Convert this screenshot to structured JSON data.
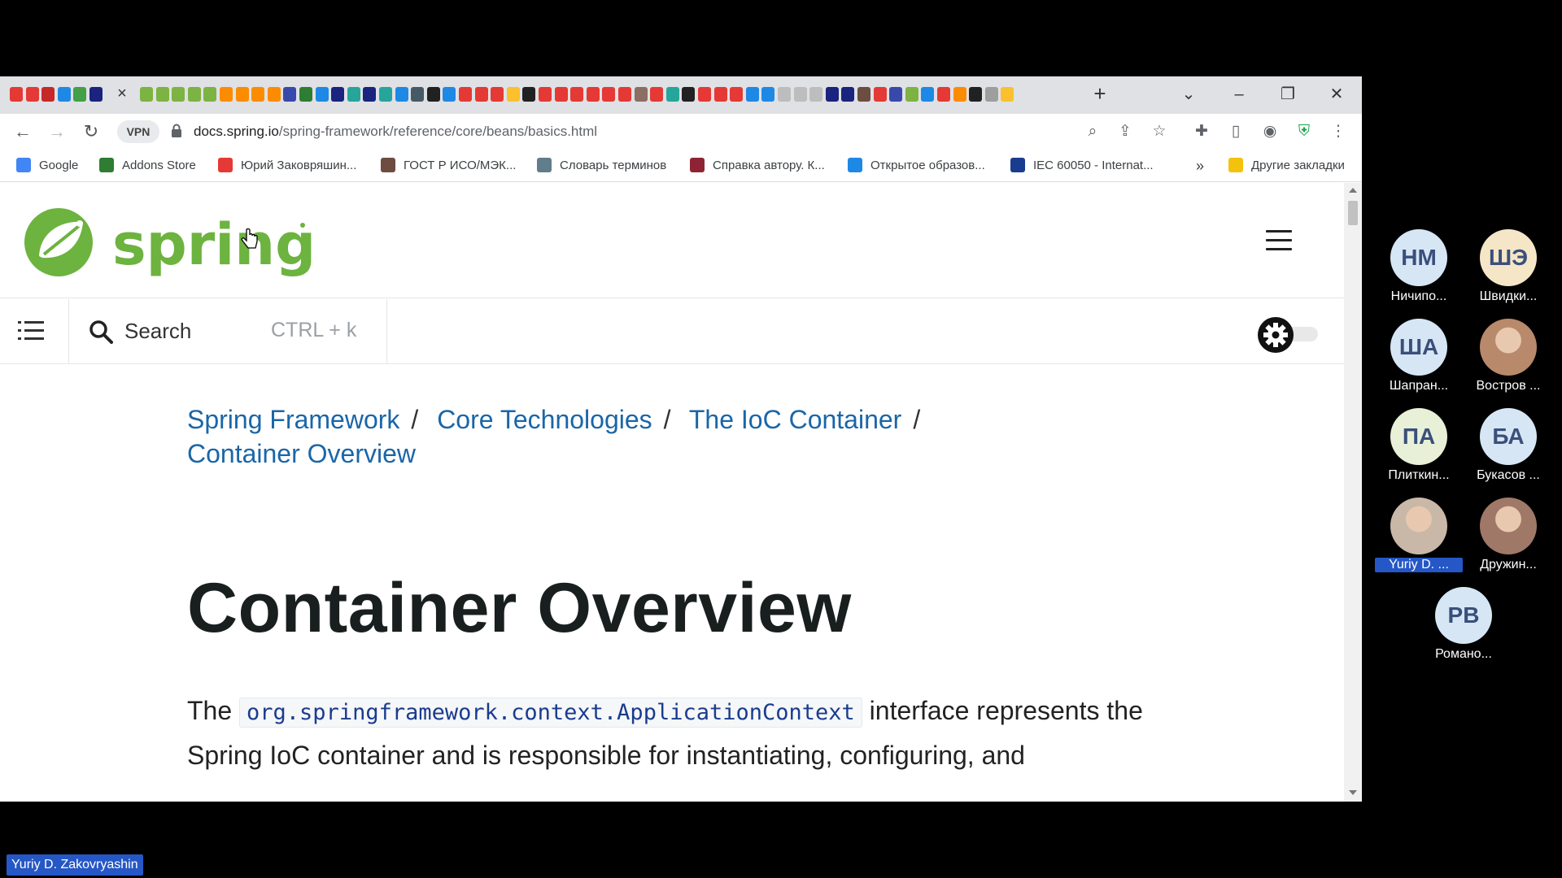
{
  "browser": {
    "url_host": "docs.spring.io",
    "url_path": "/spring-framework/reference/core/beans/basics.html",
    "vpn_label": "VPN",
    "new_tab_symbol": "+",
    "tab_close_symbol": "×"
  },
  "bookmarks": [
    {
      "label": "Google",
      "color": "#4285f4"
    },
    {
      "label": "Addons Store",
      "color": "#2e7d32"
    },
    {
      "label": "Юрий Заковряшин...",
      "color": "#e53935"
    },
    {
      "label": "ГОСТ Р ИСО/МЭК...",
      "color": "#6d4c41"
    },
    {
      "label": "Словарь терминов",
      "color": "#607d8b"
    },
    {
      "label": "Справка автору. К...",
      "color": "#8e2433"
    },
    {
      "label": "Открытое образов...",
      "color": "#1e88e5"
    },
    {
      "label": "IEC 60050 - Internat...",
      "color": "#1a3c8f"
    },
    {
      "label": "Другие закладки",
      "color": "#f4c20d"
    }
  ],
  "bookmarks_more": "»",
  "site": {
    "logo_text": "spring",
    "search_label": "Search",
    "search_shortcut": "CTRL + k",
    "accent": "#6db33f",
    "link_color": "#1a66a8"
  },
  "breadcrumb": {
    "items": [
      "Spring Framework",
      "Core Technologies",
      "The IoC Container",
      "Container Overview"
    ],
    "separator": "/"
  },
  "article": {
    "title": "Container Overview",
    "intro_before": "The ",
    "intro_code": "org.springframework.context.ApplicationContext",
    "intro_after": " interface represents the Spring IoC container and is responsible for instantiating, configuring, and"
  },
  "participants": [
    {
      "initials": "НМ",
      "name": "Ничипо...",
      "bg": "#d6e6f5"
    },
    {
      "initials": "ШЭ",
      "name": "Швидки...",
      "bg": "#f5e6c8"
    },
    {
      "initials": "ША",
      "name": "Шапран...",
      "bg": "#d6e6f5"
    },
    {
      "initials": "",
      "name": "Востров ...",
      "bg": "#b8896a",
      "photo": true
    },
    {
      "initials": "ПА",
      "name": "Плиткин...",
      "bg": "#e8f0d8"
    },
    {
      "initials": "БА",
      "name": "Букасов ...",
      "bg": "#d6e6f5"
    },
    {
      "initials": "",
      "name": "Yuriy D. ...",
      "bg": "#c9b8a8",
      "photo": true,
      "highlight": true
    },
    {
      "initials": "",
      "name": "Дружин...",
      "bg": "#a07868",
      "photo": true
    },
    {
      "initials": "РВ",
      "name": "Романо...",
      "bg": "#d6e6f5"
    }
  ],
  "speaker": "Yuriy D. Zakovryashin"
}
